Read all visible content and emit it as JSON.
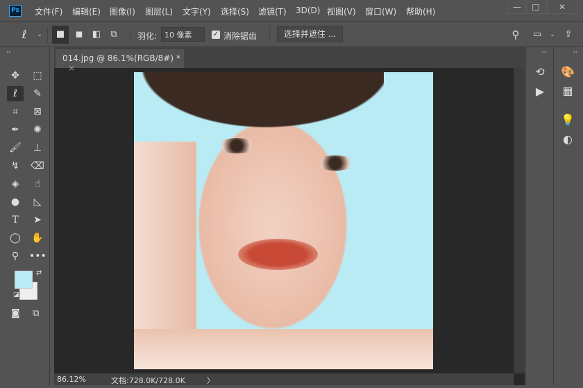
{
  "app": {
    "logo": "Ps"
  },
  "menu": [
    "文件(F)",
    "编辑(E)",
    "图像(I)",
    "图层(L)",
    "文字(Y)",
    "选择(S)",
    "滤镜(T)",
    "3D(D)",
    "视图(V)",
    "窗口(W)",
    "帮助(H)"
  ],
  "window_controls": {
    "minimize": "—",
    "maximize": "□",
    "close": "✕"
  },
  "options": {
    "feather_label": "羽化:",
    "feather_value": "10 像素",
    "antialias_label": "消除锯齿",
    "antialias_checked": true,
    "refine_label": "选择并遮住 ..."
  },
  "document": {
    "tab_title": "014.jpg @ 86.1%(RGB/8#) *",
    "close": "×"
  },
  "status": {
    "zoom": "86.12%",
    "doc_info": "文档:728.0K/728.0K",
    "arrow": "〉"
  },
  "colors": {
    "foreground": "#b9ebf5",
    "background": "#eeeeee",
    "accent": "#31a8ff"
  }
}
